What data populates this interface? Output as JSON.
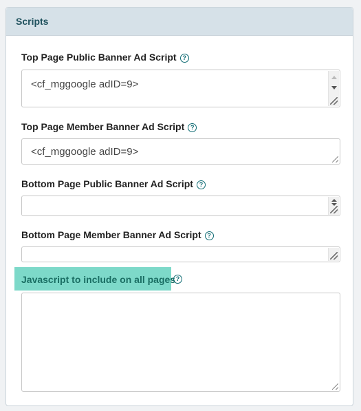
{
  "panel": {
    "title": "Scripts"
  },
  "fields": [
    {
      "label": "Top Page Public Banner Ad Script",
      "value": "<cf_mggoogle adID=9>"
    },
    {
      "label": "Top Page Member Banner Ad Script",
      "value": "<cf_mggoogle adID=9>"
    },
    {
      "label": "Bottom Page Public Banner Ad Script",
      "value": ""
    },
    {
      "label": "Bottom Page Member Banner Ad Script",
      "value": ""
    },
    {
      "label": "Javascript to include on all pages",
      "value": ""
    }
  ],
  "help_icon_glyph": "?",
  "colors": {
    "header_bg": "#d6e1e8",
    "header_text": "#20525e",
    "highlight_bg": "#7dd9c9",
    "highlight_text": "#1a6e63",
    "help_icon": "#0d6a72"
  }
}
